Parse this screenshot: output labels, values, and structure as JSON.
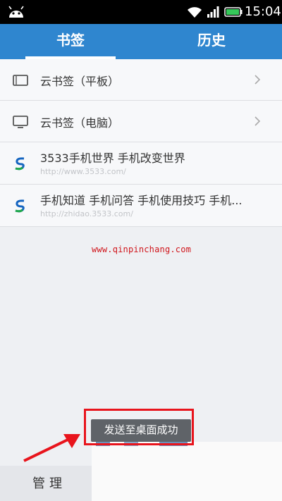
{
  "status_bar": {
    "time": "15:04",
    "icons": [
      "android-icon",
      "wifi-icon",
      "signal-icon",
      "battery-icon"
    ],
    "battery_color": "#35c759"
  },
  "tabs": [
    {
      "label": "书签",
      "selected": true
    },
    {
      "label": "历史",
      "selected": false
    }
  ],
  "bookmarks": [
    {
      "title": "云书签（平板）",
      "url": "",
      "icon": "tablet-icon",
      "has_chevron": true
    },
    {
      "title": "云书签（电脑）",
      "url": "",
      "icon": "monitor-icon",
      "has_chevron": true
    },
    {
      "title": "3533手机世界 手机改变世界",
      "url": "http://www.3533.com/",
      "icon": "site-logo-icon",
      "has_chevron": false
    },
    {
      "title": "手机知道 手机问答 手机使用技巧 手机...",
      "url": "http://zhidao.3533.com/",
      "icon": "site-logo-icon",
      "has_chevron": false
    }
  ],
  "watermark": "www.qinpinchang.com",
  "toast": "发送至桌面成功",
  "bottom": {
    "manage_label": "管理"
  },
  "colors": {
    "accent": "#2f86cf",
    "annotation": "#e8141c"
  }
}
